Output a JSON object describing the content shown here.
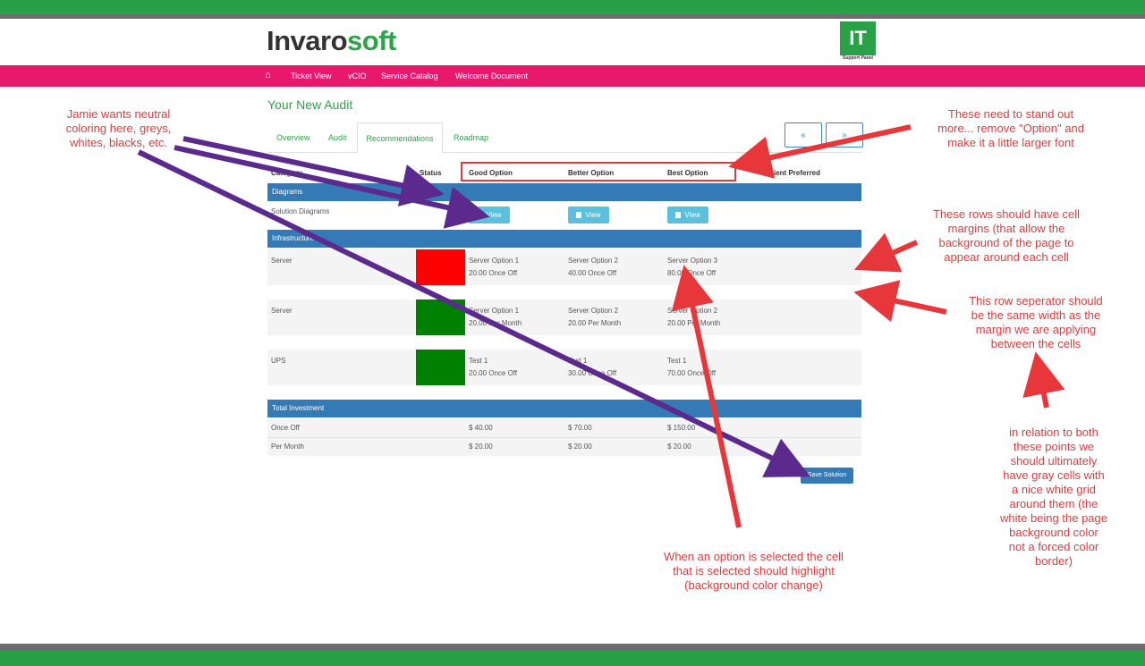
{
  "brand": {
    "logo_part1": "Invaro",
    "logo_part2": "soft",
    "badge": "IT",
    "badge_sub": "Support Panel"
  },
  "nav": {
    "items": [
      "Ticket View",
      "vCIO",
      "Service Catalog",
      "Welcome Document"
    ]
  },
  "page_title": "Your New Audit",
  "tabs": [
    "Overview",
    "Audit",
    "Recommendations",
    "Roadmap"
  ],
  "pager": {
    "prev": "«",
    "next": "»"
  },
  "table": {
    "headers": [
      "Category",
      "Status",
      "Good Option",
      "Better Option",
      "Best Option",
      "Client Preferred"
    ],
    "sections": {
      "diagrams": "Diagrams",
      "infrastructure": "Infrastructure",
      "total": "Total Investment"
    },
    "diagram_row": {
      "label": "Solution Diagrams",
      "button": "View"
    },
    "rows": [
      {
        "category": "Server",
        "status_color": "#ff0000",
        "good": [
          "Server Option 1",
          "20.00 Once Off"
        ],
        "better": [
          "Server Option 2",
          "40.00 Once Off"
        ],
        "best": [
          "Server Option 3",
          "80.00 Once Off"
        ]
      },
      {
        "category": "Server",
        "status_color": "#008000",
        "good": [
          "Server Option 1",
          "20.00 Per Month"
        ],
        "better": [
          "Server Option 2",
          "20.00 Per Month"
        ],
        "best": [
          "Server Option 2",
          "20.00 Per Month"
        ]
      },
      {
        "category": "UPS",
        "status_color": "#008000",
        "good": [
          "Test 1",
          "20.00 Once Off"
        ],
        "better": [
          "Test 1",
          "30.00 Once Off"
        ],
        "best": [
          "Test 1",
          "70.00 Once Off"
        ]
      }
    ],
    "totals": [
      {
        "label": "Once Off",
        "good": "$ 40.00",
        "better": "$ 70.00",
        "best": "$ 150.00"
      },
      {
        "label": "Per Month",
        "good": "$ 20.00",
        "better": "$ 20.00",
        "best": "$ 20.00"
      }
    ]
  },
  "save_button": "Save Solution",
  "annotations": {
    "neutral": [
      "Jamie wants neutral",
      "coloring here, greys,",
      "whites, blacks, etc."
    ],
    "standout": [
      "These need to stand out",
      "more... remove \"Option\" and",
      "make it a little larger font"
    ],
    "cell_margins": [
      "These rows should have cell",
      "margins (that allow the",
      "background of the page to",
      "appear around each cell"
    ],
    "separator": [
      "This row seperator should",
      "be the same width as the",
      "margin we are applying",
      "between the cells"
    ],
    "gray_cells": [
      "in relation to both",
      "these points we",
      "should ultimately",
      "have gray cells with",
      "a nice white grid",
      "around them (the",
      "white being the page",
      "background color",
      "not a forced color",
      "border)"
    ],
    "highlight": [
      "When an option is selected the cell",
      "that is selected should highlight",
      "(background color change)"
    ]
  },
  "colors": {
    "brand_green": "#2fa34a",
    "nav_pink": "#e8196d",
    "section_blue": "#337ab7",
    "annotation_red": "#e8373a",
    "arrow_purple": "#5b2a8c"
  }
}
